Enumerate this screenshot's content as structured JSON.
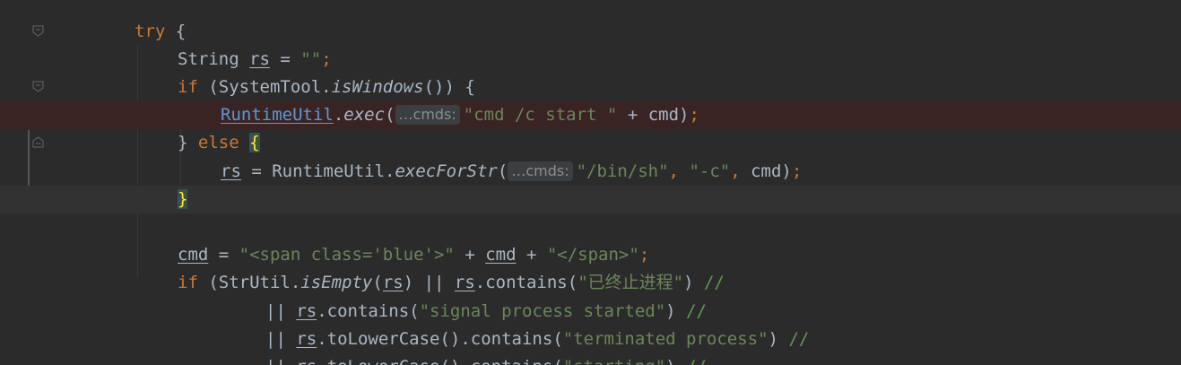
{
  "editor": {
    "lines": [
      {
        "id": "l1",
        "segs": [
          [
            "kw",
            "try"
          ],
          [
            "plain",
            " {"
          ]
        ]
      },
      {
        "id": "l2",
        "segs": [
          [
            "plain",
            "String "
          ],
          [
            "ul",
            "rs"
          ],
          [
            "plain",
            " = "
          ],
          [
            "str",
            "\"\""
          ],
          [
            "kw",
            ";"
          ]
        ]
      },
      {
        "id": "l3",
        "segs": [
          [
            "kw",
            "if"
          ],
          [
            "plain",
            " (SystemTool."
          ],
          [
            "fn-italic",
            "isWindows"
          ],
          [
            "plain",
            "()) {"
          ]
        ]
      },
      {
        "id": "l4",
        "segs": [
          [
            "link",
            "RuntimeUtil"
          ],
          [
            "plain",
            "."
          ],
          [
            "fn-italic",
            "exec"
          ],
          [
            "plain",
            "("
          ],
          [
            "hint",
            "…cmds:"
          ],
          [
            "str",
            "\"cmd /c start \""
          ],
          [
            "plain",
            " + cmd)"
          ],
          [
            "kw",
            ";"
          ]
        ]
      },
      {
        "id": "l5",
        "segs": [
          [
            "plain",
            "} "
          ],
          [
            "kw",
            "else"
          ],
          [
            "plain",
            " "
          ],
          [
            "brace-hl",
            "{"
          ]
        ]
      },
      {
        "id": "l6",
        "segs": [
          [
            "ul",
            "rs"
          ],
          [
            "plain",
            " = RuntimeUtil."
          ],
          [
            "fn-italic",
            "execForStr"
          ],
          [
            "plain",
            "("
          ],
          [
            "hint",
            "…cmds:"
          ],
          [
            "str",
            "\"/bin/sh\""
          ],
          [
            "kw",
            ", "
          ],
          [
            "str",
            "\"-c\""
          ],
          [
            "kw",
            ", "
          ],
          [
            "plain",
            "cmd)"
          ],
          [
            "kw",
            ";"
          ]
        ]
      },
      {
        "id": "l7",
        "segs": [
          [
            "brace-hl",
            "}"
          ]
        ]
      },
      {
        "id": "l8",
        "segs": []
      },
      {
        "id": "l9",
        "segs": [
          [
            "ul",
            "cmd"
          ],
          [
            "plain",
            " = "
          ],
          [
            "str",
            "\"<span class='blue'>\""
          ],
          [
            "plain",
            " + "
          ],
          [
            "ul",
            "cmd"
          ],
          [
            "plain",
            " + "
          ],
          [
            "str",
            "\"</span>\""
          ],
          [
            "kw",
            ";"
          ]
        ]
      },
      {
        "id": "l10",
        "segs": [
          [
            "kw",
            "if"
          ],
          [
            "plain",
            " (StrUtil."
          ],
          [
            "fn-italic",
            "isEmpty"
          ],
          [
            "plain",
            "("
          ],
          [
            "ul",
            "rs"
          ],
          [
            "plain",
            ") || "
          ],
          [
            "ul",
            "rs"
          ],
          [
            "plain",
            ".contains("
          ],
          [
            "str",
            "\"已终止进程\""
          ],
          [
            "plain",
            ") "
          ],
          [
            "cmt",
            "//"
          ]
        ]
      },
      {
        "id": "l11",
        "segs": [
          [
            "plain",
            "|| "
          ],
          [
            "ul",
            "rs"
          ],
          [
            "plain",
            ".contains("
          ],
          [
            "str",
            "\"signal process started\""
          ],
          [
            "plain",
            ") "
          ],
          [
            "cmt",
            "//"
          ]
        ]
      },
      {
        "id": "l12",
        "segs": [
          [
            "plain",
            "|| "
          ],
          [
            "ul",
            "rs"
          ],
          [
            "plain",
            ".toLowerCase().contains("
          ],
          [
            "str",
            "\"terminated process\""
          ],
          [
            "plain",
            ") "
          ],
          [
            "cmt",
            "//"
          ]
        ]
      },
      {
        "id": "l13",
        "segs": [
          [
            "plain",
            "|| "
          ],
          [
            "ul",
            "rs"
          ],
          [
            "plain",
            ".toLowerCase().contains("
          ],
          [
            "str",
            "\"starting\""
          ],
          [
            "plain",
            ") "
          ],
          [
            "cmt",
            "//"
          ]
        ]
      }
    ]
  },
  "colors": {
    "background": "#2b2b2b",
    "keyword": "#cc7832",
    "string": "#6a8759",
    "text": "#a9b7c6",
    "breakpoint": "#c75450",
    "breakpoint_line": "#3a2323"
  },
  "icons": {
    "breakpoint": "breakpoint-icon",
    "fold": "fold-marker-icon"
  }
}
